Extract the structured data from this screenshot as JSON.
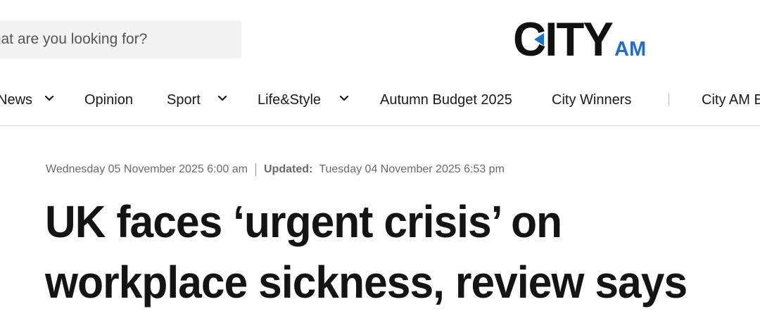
{
  "search": {
    "placeholder": "What are you looking for?"
  },
  "logo": {
    "main": "CITY",
    "sub": "AM",
    "accent_color": "#1f6fc4"
  },
  "nav": {
    "items": [
      {
        "label": "News",
        "has_dropdown": true
      },
      {
        "label": "Opinion",
        "has_dropdown": false
      },
      {
        "label": "Sport",
        "has_dropdown": true
      },
      {
        "label": "Life&Style",
        "has_dropdown": true
      },
      {
        "label": "Autumn Budget 2025",
        "has_dropdown": false
      },
      {
        "label": "City Winners",
        "has_dropdown": false
      },
      {
        "label": "City AM E",
        "has_dropdown": false
      }
    ],
    "dropdown_icon": "chevron-down-icon"
  },
  "article": {
    "published": "Wednesday 05 November 2025 6:00 am",
    "updated_label": "Updated:",
    "updated": "Tuesday 04 November 2025 6:53 pm",
    "headline_line1": "UK faces ‘urgent crisis’ on",
    "headline_line2": "workplace sickness, review says"
  }
}
